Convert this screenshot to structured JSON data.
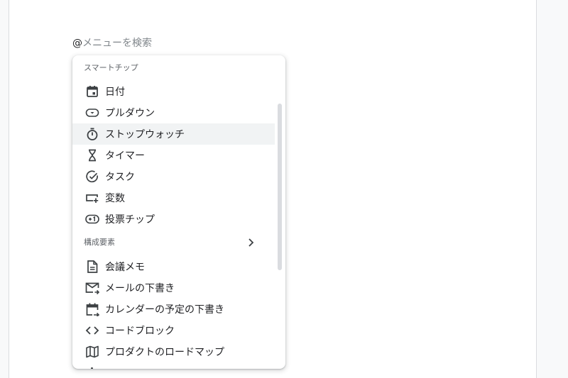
{
  "search": {
    "prefix": "@",
    "placeholder": "メニューを検索"
  },
  "menu": {
    "smart_chips_header": "スマートチップ",
    "smart_chips": [
      {
        "label": "日付",
        "icon": "calendar-icon"
      },
      {
        "label": "プルダウン",
        "icon": "dropdown-chip-icon"
      },
      {
        "label": "ストップウォッチ",
        "icon": "stopwatch-icon"
      },
      {
        "label": "タイマー",
        "icon": "hourglass-icon"
      },
      {
        "label": "タスク",
        "icon": "task-check-icon"
      },
      {
        "label": "変数",
        "icon": "variable-icon"
      },
      {
        "label": "投票チップ",
        "icon": "vote-chip-icon"
      }
    ],
    "building_blocks_header": "構成要素",
    "building_blocks": [
      {
        "label": "会議メモ",
        "icon": "document-icon"
      },
      {
        "label": "メールの下書き",
        "icon": "email-draft-icon"
      },
      {
        "label": "カレンダーの予定の下書き",
        "icon": "calendar-event-draft-icon"
      },
      {
        "label": "コードブロック",
        "icon": "code-icon"
      },
      {
        "label": "プロダクトのロードマップ",
        "icon": "map-icon"
      }
    ],
    "highlighted_item": "ストップウォッチ"
  },
  "colors": {
    "hover_bg": "#f1f3f4",
    "icon": "#3c4043",
    "text": "#202124",
    "muted": "#5f6368"
  }
}
